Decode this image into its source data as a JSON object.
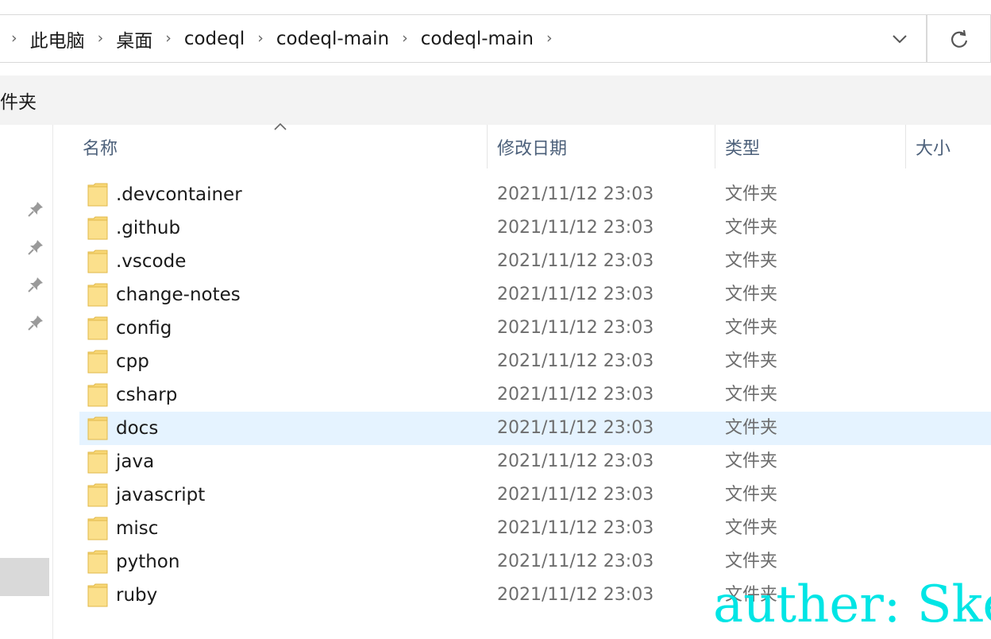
{
  "address_bar": {
    "breadcrumbs": [
      "此电脑",
      "桌面",
      "codeql",
      "codeql-main",
      "codeql-main"
    ],
    "separator": "›"
  },
  "toolbar": {
    "label": "件夹"
  },
  "columns": {
    "name": "名称",
    "date": "修改日期",
    "type": "类型",
    "size": "大小"
  },
  "files": [
    {
      "name": ".devcontainer",
      "date": "2021/11/12 23:03",
      "type": "文件夹"
    },
    {
      "name": ".github",
      "date": "2021/11/12 23:03",
      "type": "文件夹"
    },
    {
      "name": ".vscode",
      "date": "2021/11/12 23:03",
      "type": "文件夹"
    },
    {
      "name": "change-notes",
      "date": "2021/11/12 23:03",
      "type": "文件夹"
    },
    {
      "name": "config",
      "date": "2021/11/12 23:03",
      "type": "文件夹"
    },
    {
      "name": "cpp",
      "date": "2021/11/12 23:03",
      "type": "文件夹"
    },
    {
      "name": "csharp",
      "date": "2021/11/12 23:03",
      "type": "文件夹"
    },
    {
      "name": "docs",
      "date": "2021/11/12 23:03",
      "type": "文件夹",
      "selected": true
    },
    {
      "name": "java",
      "date": "2021/11/12 23:03",
      "type": "文件夹"
    },
    {
      "name": "javascript",
      "date": "2021/11/12 23:03",
      "type": "文件夹"
    },
    {
      "name": "misc",
      "date": "2021/11/12 23:03",
      "type": "文件夹"
    },
    {
      "name": "python",
      "date": "2021/11/12 23:03",
      "type": "文件夹"
    },
    {
      "name": "ruby",
      "date": "2021/11/12 23:03",
      "type": "文件夹"
    }
  ],
  "watermark": "auther: Ske",
  "colors": {
    "selected_row": "#e5f3ff",
    "header_text": "#4c607a",
    "folder_yellow": "#f8d775",
    "watermark": "#00e5e5"
  },
  "icons": [
    "chevron-down-icon",
    "refresh-icon",
    "pin-icon",
    "folder-icon",
    "sort-up-icon"
  ]
}
